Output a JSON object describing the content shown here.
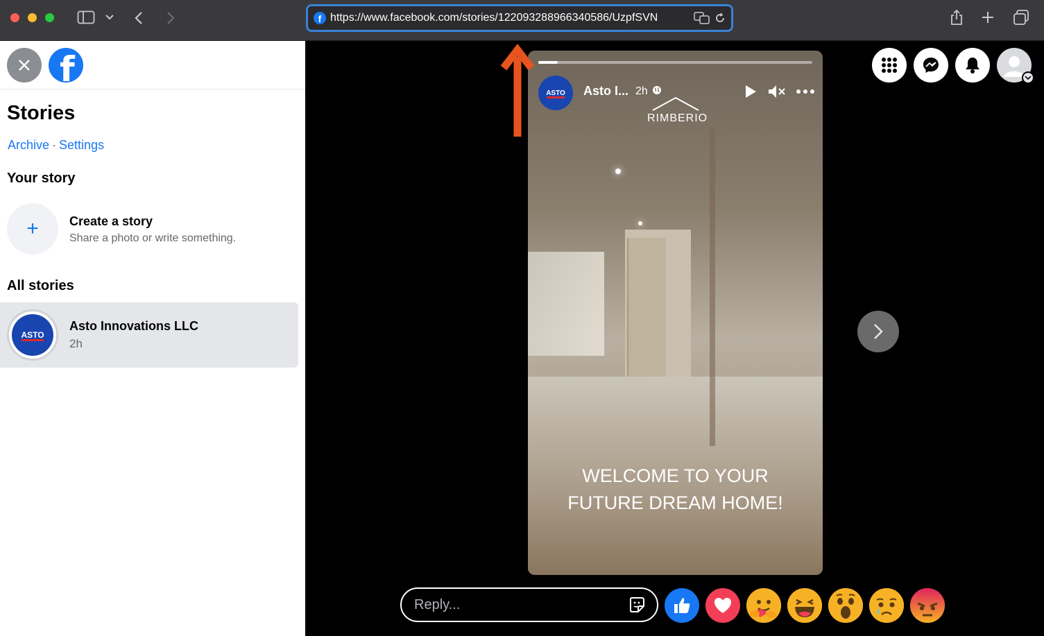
{
  "browser": {
    "url": "https://www.facebook.com/stories/122093288966340586/UzpfSVN"
  },
  "sidebar": {
    "title": "Stories",
    "links": {
      "archive": "Archive",
      "separator": "·",
      "settings": "Settings"
    },
    "your_story_heading": "Your story",
    "create": {
      "title": "Create a story",
      "subtitle": "Share a photo or write something."
    },
    "all_stories_heading": "All stories",
    "stories": [
      {
        "name": "Asto Innovations LLC",
        "time": "2h",
        "logo_text": "ASTO"
      }
    ]
  },
  "story": {
    "author_short": "Asto I...",
    "time": "2h",
    "logo_text": "ASTO",
    "brand_text": "RIMBERIO",
    "caption_line1": "WELCOME TO YOUR",
    "caption_line2": "FUTURE DREAM HOME!",
    "progress": 0.07
  },
  "reply": {
    "placeholder": "Reply..."
  },
  "reactions": [
    "like-icon",
    "love-icon",
    "care-icon",
    "haha-icon",
    "wow-icon",
    "sad-icon",
    "angry-icon"
  ],
  "colors": {
    "facebook_blue": "#1877f2",
    "annotation_arrow": "#e8541e",
    "url_focus": "#3a82d7"
  }
}
